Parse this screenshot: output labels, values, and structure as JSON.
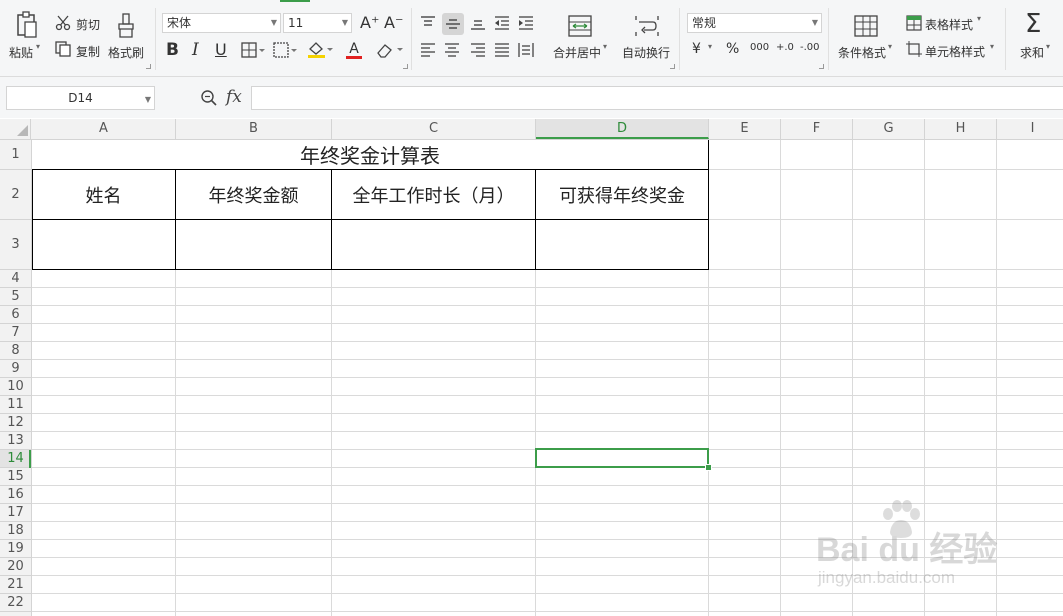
{
  "ribbon": {
    "paste": "粘贴",
    "cut": "剪切",
    "copy": "复制",
    "format_painter": "格式刷",
    "font_name": "宋体",
    "font_size": "11",
    "grow_font_glyph": "A⁺",
    "shrink_font_glyph": "A⁻",
    "bold": "B",
    "italic": "I",
    "underline": "U",
    "font_color_glyph": "A",
    "merge_center": "合并居中",
    "wrap_text": "自动换行",
    "number_format": "常规",
    "currency_glyph": "¥",
    "percent_glyph": "%",
    "thousands_glyph": "000",
    "inc_decimal_glyph": "+.0",
    "dec_decimal_glyph": "-.00",
    "conditional_format": "条件格式",
    "table_style": "表格样式",
    "cell_style": "单元格样式",
    "sum": "求和",
    "sum_glyph": "Σ"
  },
  "formula_bar": {
    "name_box": "D14",
    "fx_label": "fx",
    "value": ""
  },
  "columns": [
    "A",
    "B",
    "C",
    "D",
    "E",
    "F",
    "G",
    "H",
    "I"
  ],
  "rows": [
    "1",
    "2",
    "3",
    "4",
    "5",
    "6",
    "7",
    "8",
    "9",
    "10",
    "11",
    "12",
    "13",
    "14",
    "15",
    "16",
    "17",
    "18",
    "19",
    "20",
    "21",
    "22"
  ],
  "selected_cell": "D14",
  "sheet": {
    "title": "年终奖金计算表",
    "headers": [
      "姓名",
      "年终奖金额",
      "全年工作时长（月）",
      "可获得年终奖金"
    ]
  },
  "watermark": {
    "brand": "Bai du 经验",
    "url": "jingyan.baidu.com"
  },
  "colors": {
    "accent_green": "#3c9d4a",
    "header_bg": "#f2f2f2",
    "grid_line": "#dadada"
  },
  "icons": [
    "paste-icon",
    "cut-icon",
    "copy-icon",
    "format-painter-icon",
    "borders-icon",
    "fill-color-icon",
    "clear-icon",
    "align-top-icon",
    "align-middle-icon",
    "align-bottom-icon",
    "indent-decrease-icon",
    "indent-increase-icon",
    "align-left-icon",
    "align-center-icon",
    "align-right-icon",
    "justify-icon",
    "distributed-icon",
    "merge-icon",
    "wrap-icon",
    "conditional-format-icon",
    "table-style-icon",
    "cell-style-icon",
    "sum-icon",
    "zoom-icon"
  ]
}
